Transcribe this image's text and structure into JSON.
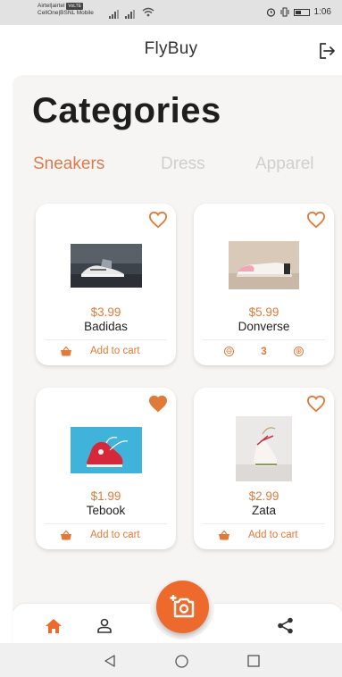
{
  "status_bar": {
    "carrier_line1": "Airtel|airtel",
    "volte": "VoLTE",
    "carrier_line2": "CellOne|BSNL Mobile",
    "time": "1:06"
  },
  "app": {
    "title": "FlyBuy"
  },
  "page": {
    "heading": "Categories"
  },
  "tabs": [
    {
      "label": "Sneakers",
      "active": true
    },
    {
      "label": "Dress",
      "active": false
    },
    {
      "label": "Apparel",
      "active": false
    }
  ],
  "products": [
    {
      "price": "$3.99",
      "name": "Badidas",
      "favorite": false,
      "action": "Add to cart"
    },
    {
      "price": "$5.99",
      "name": "Donverse",
      "favorite": false,
      "quantity": "3",
      "minus": "⊖",
      "plus": "⊕"
    },
    {
      "price": "$1.99",
      "name": "Tebook",
      "favorite": true,
      "action": "Add to cart"
    },
    {
      "price": "$2.99",
      "name": "Zata",
      "favorite": false,
      "action": "Add to cart"
    }
  ],
  "colors": {
    "accent": "#e07a3a",
    "fab": "#ee6a2c",
    "home_active": "#ee6a2c",
    "background": "#f7f5f3"
  },
  "icons": {
    "logout": "logout-icon",
    "heart": "heart-icon",
    "basket": "basket-icon",
    "camera": "add-photo-icon",
    "home": "home-icon",
    "profile": "person-icon",
    "share": "share-icon"
  }
}
